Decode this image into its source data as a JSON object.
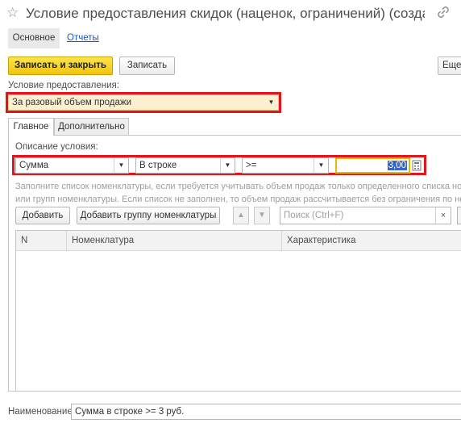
{
  "window": {
    "title": "Условие предоставления скидок (наценок, ограничений) (создание)",
    "favorite_icon": "star-outline-icon",
    "link_icon": "link-icon"
  },
  "nav": {
    "main_label": "Основное",
    "reports_label": "Отчеты"
  },
  "toolbar": {
    "save_close_label": "Записать и закрыть",
    "save_label": "Записать",
    "more_label": "Еще"
  },
  "condition": {
    "label": "Условие предоставления:",
    "value": "За разовый объем продажи"
  },
  "tabs": [
    {
      "label": "Главное",
      "active": true
    },
    {
      "label": "Дополнительно",
      "active": false
    }
  ],
  "description": {
    "label": "Описание условия:",
    "fields": {
      "kind": "Сумма",
      "scope": "В строке",
      "operator": ">=",
      "amount": "3,00"
    }
  },
  "hint": {
    "line1": "Заполните список номенклатуры, если требуется учитывать объем продаж только определенного списка номенклатуры",
    "line2": "или групп номенклатуры. Если список не заполнен, то объем продаж рассчитывается без ограничения по номенклатуре."
  },
  "list_toolbar": {
    "add_label": "Добавить",
    "add_group_label": "Добавить группу номенклатуры",
    "search_placeholder": "Поиск (Ctrl+F)",
    "clear_symbol": "×"
  },
  "table": {
    "columns": [
      "N",
      "Номенклатура",
      "Характеристика"
    ],
    "rows": []
  },
  "footer": {
    "name_label": "Наименование:",
    "name_value": "Сумма в строке >= 3 руб."
  },
  "colors": {
    "accent_yellow": "#f5cf1c",
    "highlight_red": "#e2141c",
    "link_blue": "#1a59b5",
    "condition_bg": "#fdf0d0"
  }
}
